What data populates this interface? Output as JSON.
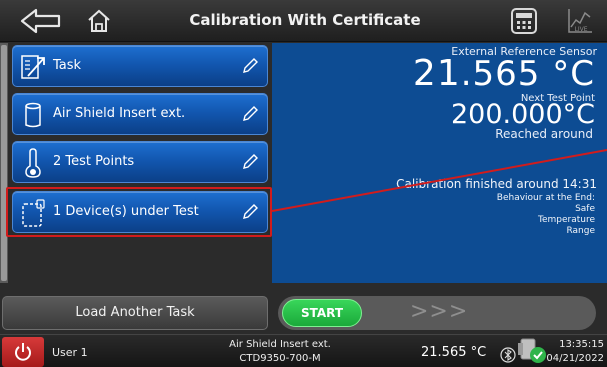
{
  "header": {
    "title": "Calibration With Certificate"
  },
  "tasks": [
    {
      "label": "Task",
      "icon": "task-chart-icon"
    },
    {
      "label": "Air Shield Insert ext.",
      "icon": "cylinder-insert-icon"
    },
    {
      "label": "2 Test Points",
      "icon": "thermometer-icon"
    },
    {
      "label": "1 Device(s) under Test",
      "icon": "device-under-test-icon"
    }
  ],
  "info": {
    "external_ref_label": "External Reference Sensor",
    "external_ref_int": "21",
    "external_ref_dec": ".565 °C",
    "next_test_point_label": "Next Test Point",
    "next_test_point_value": "200.000°C",
    "reached_text": "Reached around",
    "finished_text": "Calibration finished around 14:31",
    "behaviour_label": "Behaviour at the End:",
    "behaviour_line1": "Safe",
    "behaviour_line2": "Temperature",
    "behaviour_line3": "Range"
  },
  "actions": {
    "load_label": "Load Another Task",
    "start_label": "START",
    "arrows": ">>>"
  },
  "status": {
    "user": "User 1",
    "device_line1": "Air Shield Insert ext.",
    "device_line2": "CTD9350-700-M",
    "temperature": "21.565 °C",
    "time": "13:35:15",
    "date": "04/21/2022"
  },
  "colors": {
    "panel_blue": "#0d4c93",
    "button_blue": "#1257b0",
    "highlight_red": "#d11c1c",
    "start_green": "#1aa93a",
    "power_red": "#c22626"
  }
}
